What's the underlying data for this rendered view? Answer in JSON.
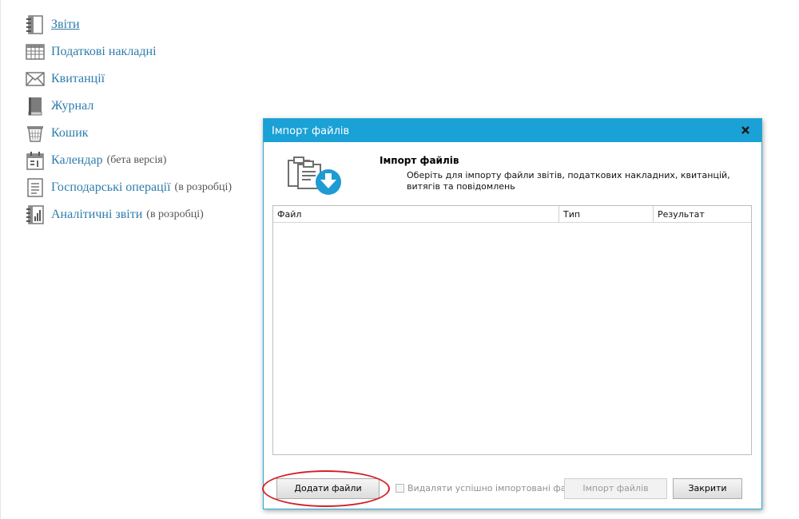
{
  "nav": {
    "items": [
      {
        "icon": "notebook-icon",
        "label": "Звіти",
        "note": ""
      },
      {
        "icon": "table-grid-icon",
        "label": "Податкові накладні",
        "note": ""
      },
      {
        "icon": "envelope-icon",
        "label": "Квитанції",
        "note": ""
      },
      {
        "icon": "book-icon",
        "label": "Журнал",
        "note": ""
      },
      {
        "icon": "trash-icon",
        "label": "Кошик",
        "note": ""
      },
      {
        "icon": "calendar-icon",
        "label": "Календар",
        "note": "(бета версія)"
      },
      {
        "icon": "document-list-icon",
        "label": "Господарські операції",
        "note": "(в розробці)"
      },
      {
        "icon": "analytics-notebook-icon",
        "label": "Аналітичні звіти",
        "note": "(в розробці)"
      }
    ]
  },
  "dialog": {
    "window_title": "Імпорт файлів",
    "close_glyph": "x",
    "header_icon": "import-files-icon",
    "header_title": "Імпорт файлів",
    "header_description": "Оберіть для імпорту файли звітів, податкових накладних, квитанцій, витягів та повідомлень",
    "table": {
      "columns": [
        "Файл",
        "Тип",
        "Результат"
      ],
      "rows": []
    },
    "add_files_button": "Додати файли",
    "delete_imported_label": "Видаляти успішно імпортовані файли",
    "delete_imported_checked": false,
    "import_button": "Імпорт файлів",
    "close_button": "Закрити"
  },
  "colors": {
    "link": "#2e7cab",
    "titlebar": "#1aa1d6",
    "highlight": "#d12229"
  }
}
